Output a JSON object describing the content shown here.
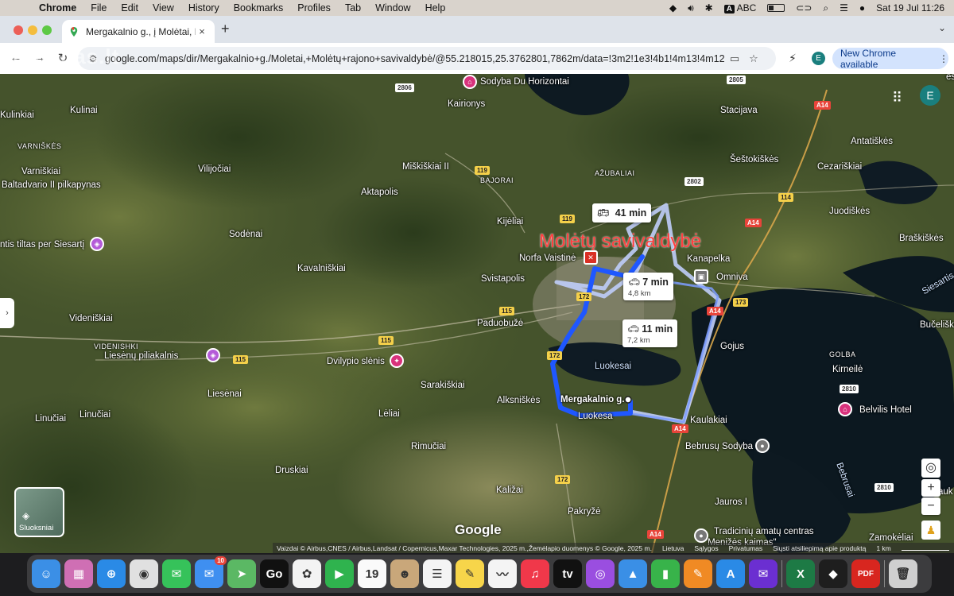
{
  "menubar": {
    "app": "Chrome",
    "items": [
      "File",
      "Edit",
      "View",
      "History",
      "Bookmarks",
      "Profiles",
      "Tab",
      "Window",
      "Help"
    ],
    "input_source": "A",
    "input_label": "ABC",
    "datetime": "Sat 19 Jul  11:26"
  },
  "tab": {
    "title": "Mergakalnio g., į Molėtai, Molė",
    "close": "×",
    "new_tab": "+"
  },
  "toolbar": {
    "url": "google.com/maps/dir/Mergakalnio+g./Moletai,+Molėtų+rajono+savivaldybė/@55.218015,25.3762801,7862m/data=!3m2!1e3!4b1!4m13!4m12...",
    "profile_letter": "E",
    "new_chrome": "New Chrome available",
    "watermark": "aruodas.lt"
  },
  "map": {
    "account_letter": "E",
    "layers_label": "Sluoksniai",
    "google": "Google",
    "labels": [
      {
        "text": "Kulinai",
        "cls": ""
      },
      {
        "text": "VARNIŠKĖS",
        "cls": "caps"
      },
      {
        "text": "Varniškiai",
        "cls": ""
      },
      {
        "text": "Baltadvario II pilkapynas",
        "cls": ""
      },
      {
        "text": "Vilijočiai",
        "cls": ""
      },
      {
        "text": "Kulinkiai",
        "cls": ""
      },
      {
        "text": "Kairionys",
        "cls": ""
      },
      {
        "text": "Miškiškiai II",
        "cls": ""
      },
      {
        "text": "Aktapolis",
        "cls": ""
      },
      {
        "text": "BAJORAI",
        "cls": "caps"
      },
      {
        "text": "AŽUBALIAI",
        "cls": "caps"
      },
      {
        "text": "Stacijava",
        "cls": ""
      },
      {
        "text": "Šeštokiškės",
        "cls": ""
      },
      {
        "text": "Antatiškės",
        "cls": ""
      },
      {
        "text": "Cezariškiai",
        "cls": ""
      },
      {
        "text": "Juodiškės",
        "cls": ""
      },
      {
        "text": "Kijėliai",
        "cls": ""
      },
      {
        "text": "Sodėnai",
        "cls": ""
      },
      {
        "text": "ntis tiltas per Siesartį",
        "cls": ""
      },
      {
        "text": "Molėtų savivaldybė",
        "cls": "big"
      },
      {
        "text": "Norfa Vaistinė",
        "cls": ""
      },
      {
        "text": "Kanapelka",
        "cls": ""
      },
      {
        "text": "Omniva",
        "cls": ""
      },
      {
        "text": "Braškiškės",
        "cls": ""
      },
      {
        "text": "Kavalniškiai",
        "cls": ""
      },
      {
        "text": "Svistapolis",
        "cls": ""
      },
      {
        "text": "Videniškiai",
        "cls": ""
      },
      {
        "text": "Paduobužė",
        "cls": ""
      },
      {
        "text": "VIDENISHKI",
        "cls": "caps"
      },
      {
        "text": "Liesėnų piliakalnis",
        "cls": ""
      },
      {
        "text": "Dvilypio slėnis",
        "cls": ""
      },
      {
        "text": "Gojus",
        "cls": ""
      },
      {
        "text": "GOLBA",
        "cls": "caps"
      },
      {
        "text": "Bučeliškės",
        "cls": ""
      },
      {
        "text": "Kirneilė",
        "cls": ""
      },
      {
        "text": "Luokesai",
        "cls": "water"
      },
      {
        "text": "Sarakiškiai",
        "cls": ""
      },
      {
        "text": "Alksniškės",
        "cls": ""
      },
      {
        "text": "Mergakalnio g.",
        "cls": ""
      },
      {
        "text": "Luokesa",
        "cls": ""
      },
      {
        "text": "Liesėnai",
        "cls": ""
      },
      {
        "text": "Lėliai",
        "cls": ""
      },
      {
        "text": "Linučiai",
        "cls": ""
      },
      {
        "text": "Linučiai",
        "cls": ""
      },
      {
        "text": "Kaulakiai",
        "cls": ""
      },
      {
        "text": "Belvilis Hotel",
        "cls": ""
      },
      {
        "text": "Bebrusų Sodyba",
        "cls": ""
      },
      {
        "text": "Rimučiai",
        "cls": ""
      },
      {
        "text": "Druskiai",
        "cls": ""
      },
      {
        "text": "Kaližai",
        "cls": ""
      },
      {
        "text": "Pakryžė",
        "cls": ""
      },
      {
        "text": "Jauros I",
        "cls": ""
      },
      {
        "text": "Bebrusai",
        "cls": "water"
      },
      {
        "text": "Tradicinių amatų centras",
        "cls": ""
      },
      {
        "text": "\"Menižės kaimas\"",
        "cls": ""
      },
      {
        "text": "Zamokėliai",
        "cls": ""
      },
      {
        "text": "Sodyba Du Horizontai",
        "cls": ""
      },
      {
        "text": "Siesartis",
        "cls": "water"
      },
      {
        "text": "esai",
        "cls": ""
      },
      {
        "text": "auk",
        "cls": ""
      }
    ],
    "shields": [
      {
        "text": "2806",
        "cls": "wh"
      },
      {
        "text": "2805",
        "cls": "wh"
      },
      {
        "text": "A14",
        "cls": "a"
      },
      {
        "text": "119",
        "cls": ""
      },
      {
        "text": "2802",
        "cls": "wh"
      },
      {
        "text": "119",
        "cls": ""
      },
      {
        "text": "114",
        "cls": ""
      },
      {
        "text": "A14",
        "cls": "a"
      },
      {
        "text": "172",
        "cls": ""
      },
      {
        "text": "173",
        "cls": ""
      },
      {
        "text": "A14",
        "cls": "a"
      },
      {
        "text": "115",
        "cls": ""
      },
      {
        "text": "115",
        "cls": ""
      },
      {
        "text": "115",
        "cls": ""
      },
      {
        "text": "172",
        "cls": ""
      },
      {
        "text": "2810",
        "cls": "wh"
      },
      {
        "text": "A14",
        "cls": "a"
      },
      {
        "text": "172",
        "cls": ""
      },
      {
        "text": "2810",
        "cls": "wh"
      },
      {
        "text": "A14",
        "cls": "a"
      }
    ],
    "routes": [
      {
        "time": "41 min",
        "dist": "",
        "mode": "transit"
      },
      {
        "time": "7 min",
        "dist": "4,8 km",
        "mode": "car"
      },
      {
        "time": "11 min",
        "dist": "7,2 km",
        "mode": "car"
      }
    ],
    "attribution": [
      "Vaizdai © Airbus,CNES / Airbus,Landsat / Copernicus,Maxar Technologies, 2025 m.,Žemėlapio duomenys © Google, 2025 m.",
      "Lietuva",
      "Sąlygos",
      "Privatumas",
      "Siųsti atsiliepimą apie produktą",
      "1 km"
    ]
  },
  "dock": {
    "apps": [
      {
        "name": "Finder",
        "glyph": "☺",
        "color": "#3b8fe6"
      },
      {
        "name": "Launchpad",
        "glyph": "▦",
        "color": "#cf6fb4"
      },
      {
        "name": "Safari",
        "glyph": "⊕",
        "color": "#2a8ae6"
      },
      {
        "name": "Chrome",
        "glyph": "◉",
        "color": "#e0e0e0"
      },
      {
        "name": "Messages",
        "glyph": "✉",
        "color": "#36c25a"
      },
      {
        "name": "Mail",
        "glyph": "✉",
        "color": "#3f8ff0",
        "badge": "10"
      },
      {
        "name": "Maps",
        "glyph": "➤",
        "color": "#5bb864"
      },
      {
        "name": "Go3",
        "glyph": "Go",
        "color": "#111"
      },
      {
        "name": "Photos",
        "glyph": "✿",
        "color": "#f3f3f3"
      },
      {
        "name": "FaceTime",
        "glyph": "▶",
        "color": "#2fb34e"
      },
      {
        "name": "Calendar",
        "glyph": "19",
        "color": "#fafafa"
      },
      {
        "name": "Contacts",
        "glyph": "☻",
        "color": "#c9a77a"
      },
      {
        "name": "Reminders",
        "glyph": "☰",
        "color": "#f4f4f4"
      },
      {
        "name": "Notes",
        "glyph": "✎",
        "color": "#f7d54a"
      },
      {
        "name": "Freeform",
        "glyph": "〰",
        "color": "#f4f4f4"
      },
      {
        "name": "Music",
        "glyph": "♫",
        "color": "#f0384a"
      },
      {
        "name": "TV",
        "glyph": "tv",
        "color": "#111"
      },
      {
        "name": "Podcasts",
        "glyph": "◎",
        "color": "#9a4ee0"
      },
      {
        "name": "Keynote",
        "glyph": "▲",
        "color": "#3a8fe6"
      },
      {
        "name": "Numbers",
        "glyph": "▮",
        "color": "#38b34a"
      },
      {
        "name": "Pages",
        "glyph": "✎",
        "color": "#f08a24"
      },
      {
        "name": "App Store",
        "glyph": "A",
        "color": "#2a8ae6"
      },
      {
        "name": "Yahoo Mail",
        "glyph": "✉",
        "color": "#6b2fd1"
      },
      {
        "name": "Excel",
        "glyph": "X",
        "color": "#1d7a45"
      },
      {
        "name": "Binance",
        "glyph": "◆",
        "color": "#1e1e1e"
      },
      {
        "name": "PDF",
        "glyph": "PDF",
        "color": "#d8261f"
      },
      {
        "name": "Trash",
        "glyph": "🗑",
        "color": "#cfcfcf"
      }
    ]
  }
}
